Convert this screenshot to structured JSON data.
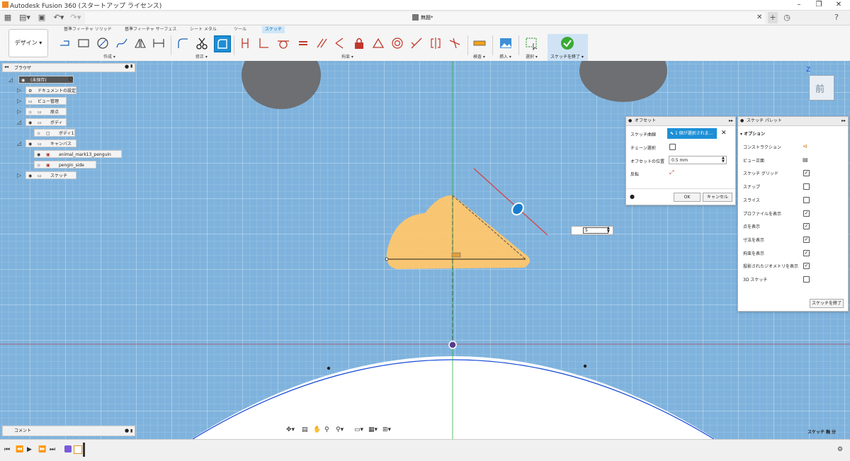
{
  "app": {
    "title": "Autodesk Fusion 360 (スタートアップ ライセンス)",
    "doc_title": "無題*"
  },
  "ribbon": {
    "workspace": "デザイン",
    "tabs": [
      "基準フィーチャ ソリッド",
      "基準フィーチャ サーフェス",
      "シート メタル",
      "ツール",
      "スケッチ"
    ],
    "groups": {
      "create": "作成",
      "modify": "修正",
      "constrain": "拘束",
      "inspect": "検査",
      "insert": "挿入",
      "select": "選択",
      "finish": "スケッチを終了"
    }
  },
  "browser": {
    "title": "ブラウザ",
    "root": "(未保存)",
    "nodes": [
      "ドキュメントの設定",
      "ビュー管理",
      "原点",
      "ボディ",
      "ボディ1",
      "キャンバス",
      "animal_mark13_penguin",
      "pengin_side",
      "スケッチ"
    ]
  },
  "comment": {
    "label": "コメント"
  },
  "viewcube": {
    "label": "前",
    "axis_z": "Z"
  },
  "offset_panel": {
    "title": "オフセット",
    "sketch_curve_label": "スケッチ曲線",
    "sketch_curve_value": "1 個が選択されま...",
    "chain_label": "チェーン選択",
    "chain_checked": false,
    "position_label": "オフセットの位置",
    "position_value": "0.5 mm",
    "flip_label": "反転",
    "ok": "OK",
    "cancel": "キャンセル"
  },
  "dim_input": {
    "value": "5"
  },
  "palette": {
    "title": "スケッチ パレット",
    "section": "オプション",
    "options": [
      {
        "label": "コンストラクション",
        "type": "icon"
      },
      {
        "label": "ビュー正面",
        "type": "icon"
      },
      {
        "label": "スケッチ グリッド",
        "checked": true
      },
      {
        "label": "スナップ",
        "checked": false
      },
      {
        "label": "スライス",
        "checked": false
      },
      {
        "label": "プロファイルを表示",
        "checked": true
      },
      {
        "label": "点を表示",
        "checked": true
      },
      {
        "label": "寸法を表示",
        "checked": true
      },
      {
        "label": "拘束を表示",
        "checked": true
      },
      {
        "label": "投影されたジオメトリを表示",
        "checked": true
      },
      {
        "label": "3D スケッチ",
        "checked": false
      }
    ],
    "finish": "スケッチを終了"
  },
  "status": {
    "text": "スケッチ 融 分"
  },
  "colors": {
    "accent": "#0696d7",
    "canvas": "#7fb3dd",
    "profile": "#ffc66d",
    "constraint": "#c0392b"
  }
}
